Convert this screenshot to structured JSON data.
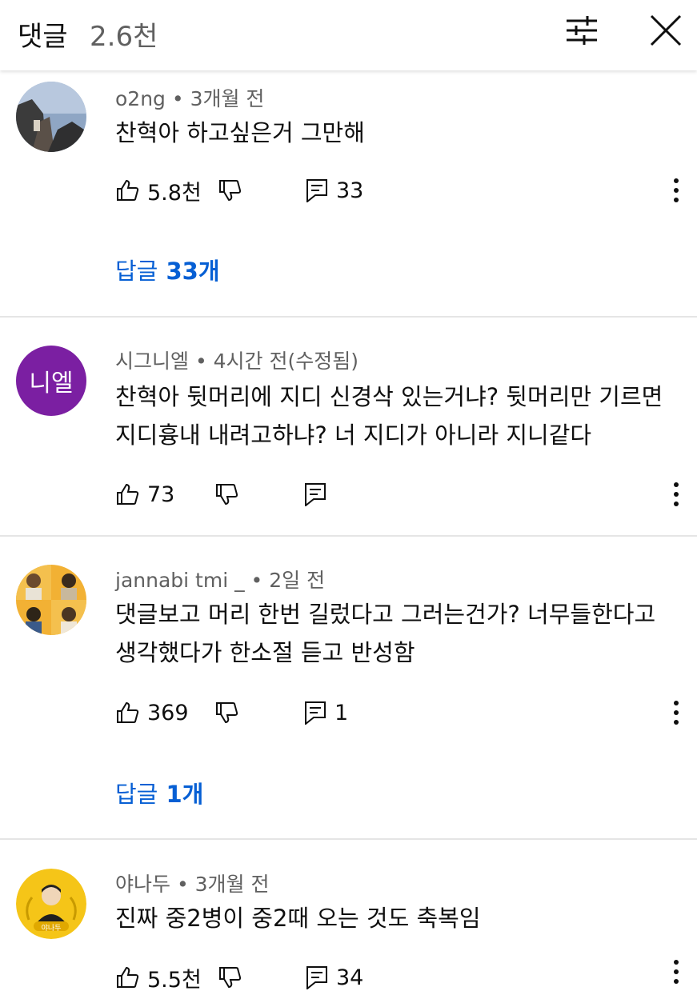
{
  "header": {
    "title": "댓글",
    "count": "2.6천"
  },
  "comments": [
    {
      "author": "o2ng",
      "time": "3개월 전",
      "text_lines": [
        "찬혁아 하고싶은거 그만해"
      ],
      "likes": "5.8천",
      "reply_count": "33",
      "replies_label": "답글",
      "replies_count": "33개"
    },
    {
      "author": "시그니엘",
      "time": "4시간 전(수정됨)",
      "avatar_text": "니엘",
      "avatar_color": "#7b1fa2",
      "text_lines": [
        "찬혁아 뒷머리에 지디 신경삭 있는거냐? 뒷머리만 기르면",
        "지디흉내 내려고하냐? 너 지디가 아니라 지니같다"
      ],
      "likes": "73",
      "reply_count": ""
    },
    {
      "author": "jannabi tmi _",
      "time": "2일 전",
      "text_lines": [
        "댓글보고 머리 한번 길렀다고 그러는건가? 너무들한다고",
        "생각했다가 한소절 듣고 반성함"
      ],
      "likes": "369",
      "reply_count": "1",
      "replies_label": "답글",
      "replies_count": "1개"
    },
    {
      "author": "야나두",
      "time": "3개월 전",
      "avatar_text": "야나두",
      "text_lines": [
        "진짜 중2병이 중2때 오는 것도 축복임"
      ],
      "likes": "5.5천",
      "reply_count": "34"
    }
  ],
  "colors": {
    "link": "#065fd4",
    "meta": "#606060",
    "divider": "#e5e5e5"
  }
}
